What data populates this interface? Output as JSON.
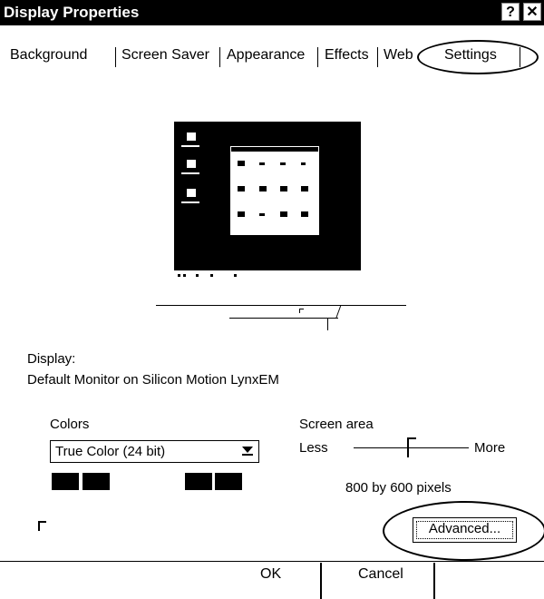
{
  "window": {
    "title": "Display Properties",
    "help_label": "?",
    "close_label": "✕"
  },
  "tabs": [
    {
      "label": "Background"
    },
    {
      "label": "Screen Saver"
    },
    {
      "label": "Appearance"
    },
    {
      "label": "Effects"
    },
    {
      "label": "Web"
    },
    {
      "label": "Settings",
      "selected": true
    }
  ],
  "display": {
    "label": "Display:",
    "value": "Default Monitor on Silicon Motion LynxEM"
  },
  "colors": {
    "label": "Colors",
    "selected_value": "True Color (24 bit)"
  },
  "screen_area": {
    "label": "Screen area",
    "less_label": "Less",
    "more_label": "More",
    "value_text": "800 by 600 pixels"
  },
  "buttons": {
    "advanced_label": "Advanced...",
    "ok_label": "OK",
    "cancel_label": "Cancel"
  },
  "colors_palette": {
    "background": "#ffffff",
    "foreground": "#000000"
  }
}
